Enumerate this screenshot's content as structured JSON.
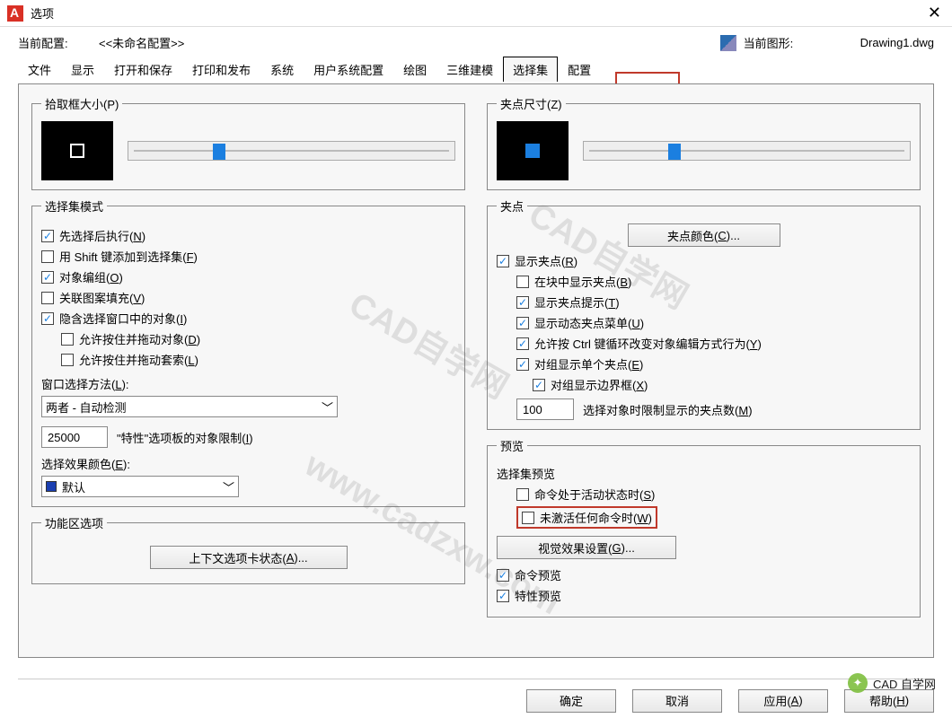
{
  "window": {
    "title": "选项"
  },
  "profile": {
    "config_label": "当前配置:",
    "config_value": "<<未命名配置>>",
    "drawing_label": "当前图形:",
    "drawing_value": "Drawing1.dwg"
  },
  "tabs": [
    "文件",
    "显示",
    "打开和保存",
    "打印和发布",
    "系统",
    "用户系统配置",
    "绘图",
    "三维建模",
    "选择集",
    "配置"
  ],
  "left": {
    "pick_legend": "拾取框大小(P)",
    "mode_legend": "选择集模式",
    "mode_items": [
      {
        "label": "先选择后执行(N)",
        "checked": true,
        "indent": 0
      },
      {
        "label": "用 Shift 键添加到选择集(F)",
        "checked": false,
        "indent": 0
      },
      {
        "label": "对象编组(O)",
        "checked": true,
        "indent": 0
      },
      {
        "label": "关联图案填充(V)",
        "checked": false,
        "indent": 0
      },
      {
        "label": "隐含选择窗口中的对象(I)",
        "checked": true,
        "indent": 0
      },
      {
        "label": "允许按住并拖动对象(D)",
        "checked": false,
        "indent": 1
      },
      {
        "label": "允许按住并拖动套索(L)",
        "checked": false,
        "indent": 1
      }
    ],
    "window_method_label": "窗口选择方法(L):",
    "window_method_value": "两者 - 自动检测",
    "limit_value": "25000",
    "limit_label": "\"特性\"选项板的对象限制(I)",
    "eff_color_label": "选择效果颜色(E):",
    "eff_color_value": "默认",
    "ribbon_legend": "功能区选项",
    "ribbon_button": "上下文选项卡状态(A)..."
  },
  "right": {
    "grip_size_legend": "夹点尺寸(Z)",
    "grip_legend": "夹点",
    "grip_color_button": "夹点颜色(C)...",
    "grip_items": [
      {
        "label": "显示夹点(R)",
        "checked": true,
        "indent": 0
      },
      {
        "label": "在块中显示夹点(B)",
        "checked": false,
        "indent": 1
      },
      {
        "label": "显示夹点提示(T)",
        "checked": true,
        "indent": 1
      },
      {
        "label": "显示动态夹点菜单(U)",
        "checked": true,
        "indent": 1
      },
      {
        "label": "允许按 Ctrl 键循环改变对象编辑方式行为(Y)",
        "checked": true,
        "indent": 1
      },
      {
        "label": "对组显示单个夹点(E)",
        "checked": true,
        "indent": 1
      },
      {
        "label": "对组显示边界框(X)",
        "checked": true,
        "indent": 2
      }
    ],
    "grip_limit_value": "100",
    "grip_limit_label": "选择对象时限制显示的夹点数(M)",
    "preview_legend": "预览",
    "preview_sub": "选择集预览",
    "preview_items": [
      {
        "label": "命令处于活动状态时(S)",
        "checked": false
      },
      {
        "label": "未激活任何命令时(W)",
        "checked": false
      }
    ],
    "visual_button": "视觉效果设置(G)...",
    "cmd_preview": {
      "label": "命令预览",
      "checked": true
    },
    "prop_preview": {
      "label": "特性预览",
      "checked": true
    }
  },
  "footer": {
    "ok": "确定",
    "cancel": "取消",
    "apply": "应用(A)",
    "help": "帮助(H)"
  },
  "watermark": {
    "diag": "CAD自学网",
    "url": "www.cadzxw.com"
  },
  "brand": "CAD 自学网"
}
